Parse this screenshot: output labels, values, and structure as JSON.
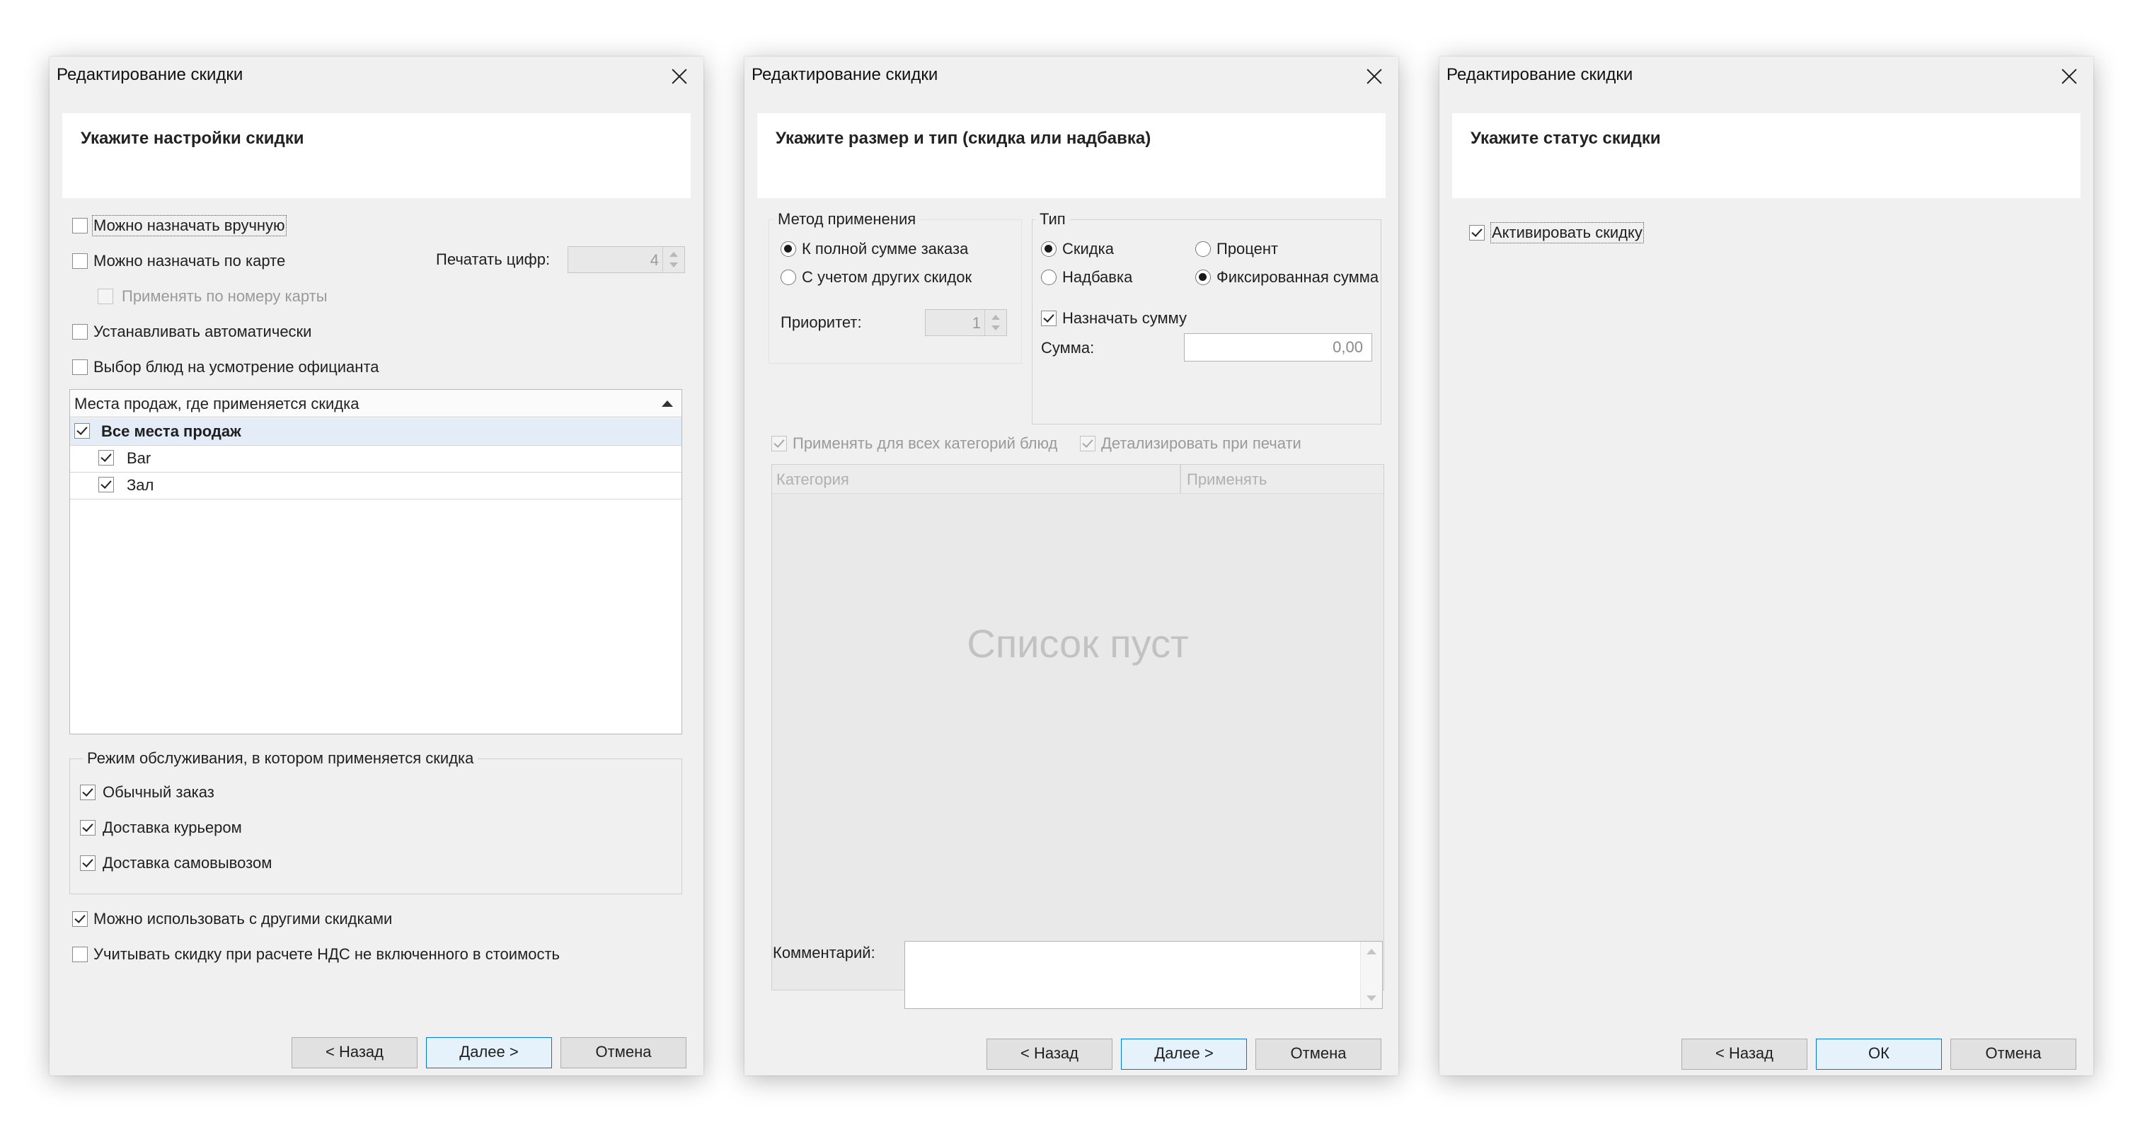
{
  "dialog1": {
    "title": "Редактирование скидки",
    "header": "Укажите настройки скидки",
    "manual": "Можно назначать вручную",
    "by_card": "Можно назначать по карте",
    "print_digits_label": "Печатать цифр:",
    "print_digits_value": "4",
    "by_card_number": "Применять по номеру карты",
    "auto": "Устанавливать автоматически",
    "waiter_choice": "Выбор блюд на усмотрение официанта",
    "places_header": "Места продаж, где применяется скидка",
    "places_all": "Все места продаж",
    "places": [
      "Bar",
      "Зал"
    ],
    "service_group": "Режим обслуживания, в котором применяется скидка",
    "service_modes": [
      "Обычный заказ",
      "Доставка курьером",
      "Доставка самовывозом"
    ],
    "combine": "Можно использовать с другими скидками",
    "vat": "Учитывать скидку при расчете НДС не включенного в стоимость",
    "btn_back": "< Назад",
    "btn_next": "Далее >",
    "btn_cancel": "Отмена"
  },
  "dialog2": {
    "title": "Редактирование скидки",
    "header": "Укажите размер и тип (скидка или надбавка)",
    "method_group": "Метод применения",
    "method_full": "К полной сумме заказа",
    "method_others": "С учетом других скидок",
    "priority_label": "Приоритет:",
    "priority_value": "1",
    "type_group": "Тип",
    "type_discount": "Скидка",
    "type_percent": "Процент",
    "type_markup": "Надбавка",
    "type_fixed": "Фиксированная сумма",
    "assign_sum": "Назначать сумму",
    "sum_label": "Сумма:",
    "sum_value": "0,00",
    "apply_all_categories": "Применять для всех категорий блюд",
    "detail_print": "Детализировать при печати",
    "col_category": "Категория",
    "col_apply": "Применять",
    "empty": "Список пуст",
    "comment_label": "Комментарий:",
    "btn_back": "< Назад",
    "btn_next": "Далее >",
    "btn_cancel": "Отмена"
  },
  "dialog3": {
    "title": "Редактирование скидки",
    "header": "Укажите статус скидки",
    "activate": "Активировать скидку",
    "btn_back": "< Назад",
    "btn_ok": "ОК",
    "btn_cancel": "Отмена"
  },
  "icons": {
    "close": "close-icon",
    "checkbox": "checkbox",
    "radio": "radio-button",
    "sort": "sort-arrow-icon"
  }
}
